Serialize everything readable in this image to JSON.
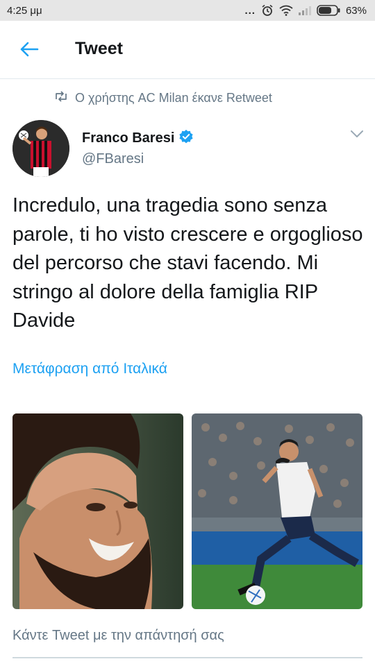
{
  "status_bar": {
    "time": "4:25 μμ",
    "dots": "...",
    "battery_percent": "63%",
    "icons": [
      "alarm-icon",
      "wifi-icon",
      "signal-icon",
      "battery-icon"
    ]
  },
  "header": {
    "title": "Tweet",
    "back_icon": "arrow-left-icon"
  },
  "retweet": {
    "text": "Ο χρήστης AC Milan έκανε Retweet",
    "icon": "retweet-icon"
  },
  "tweet": {
    "author_name": "Franco Baresi",
    "verified": true,
    "handle": "@FBaresi",
    "text": "Incredulo, una tragedia sono senza parole, ti ho visto crescere e orgoglioso del percorso che stavi facendo. Mi stringo al dolore della famiglia RIP Davide",
    "translate_label": "Μετάφραση από Ιταλικά",
    "media": [
      "portrait-photo",
      "football-action-photo"
    ]
  },
  "reply": {
    "placeholder": "Κάντε Tweet με την απάντησή σας"
  },
  "colors": {
    "accent": "#1da1f2",
    "secondary_text": "#657786",
    "primary_text": "#14171a",
    "status_bar_bg": "#e6e6e6"
  }
}
